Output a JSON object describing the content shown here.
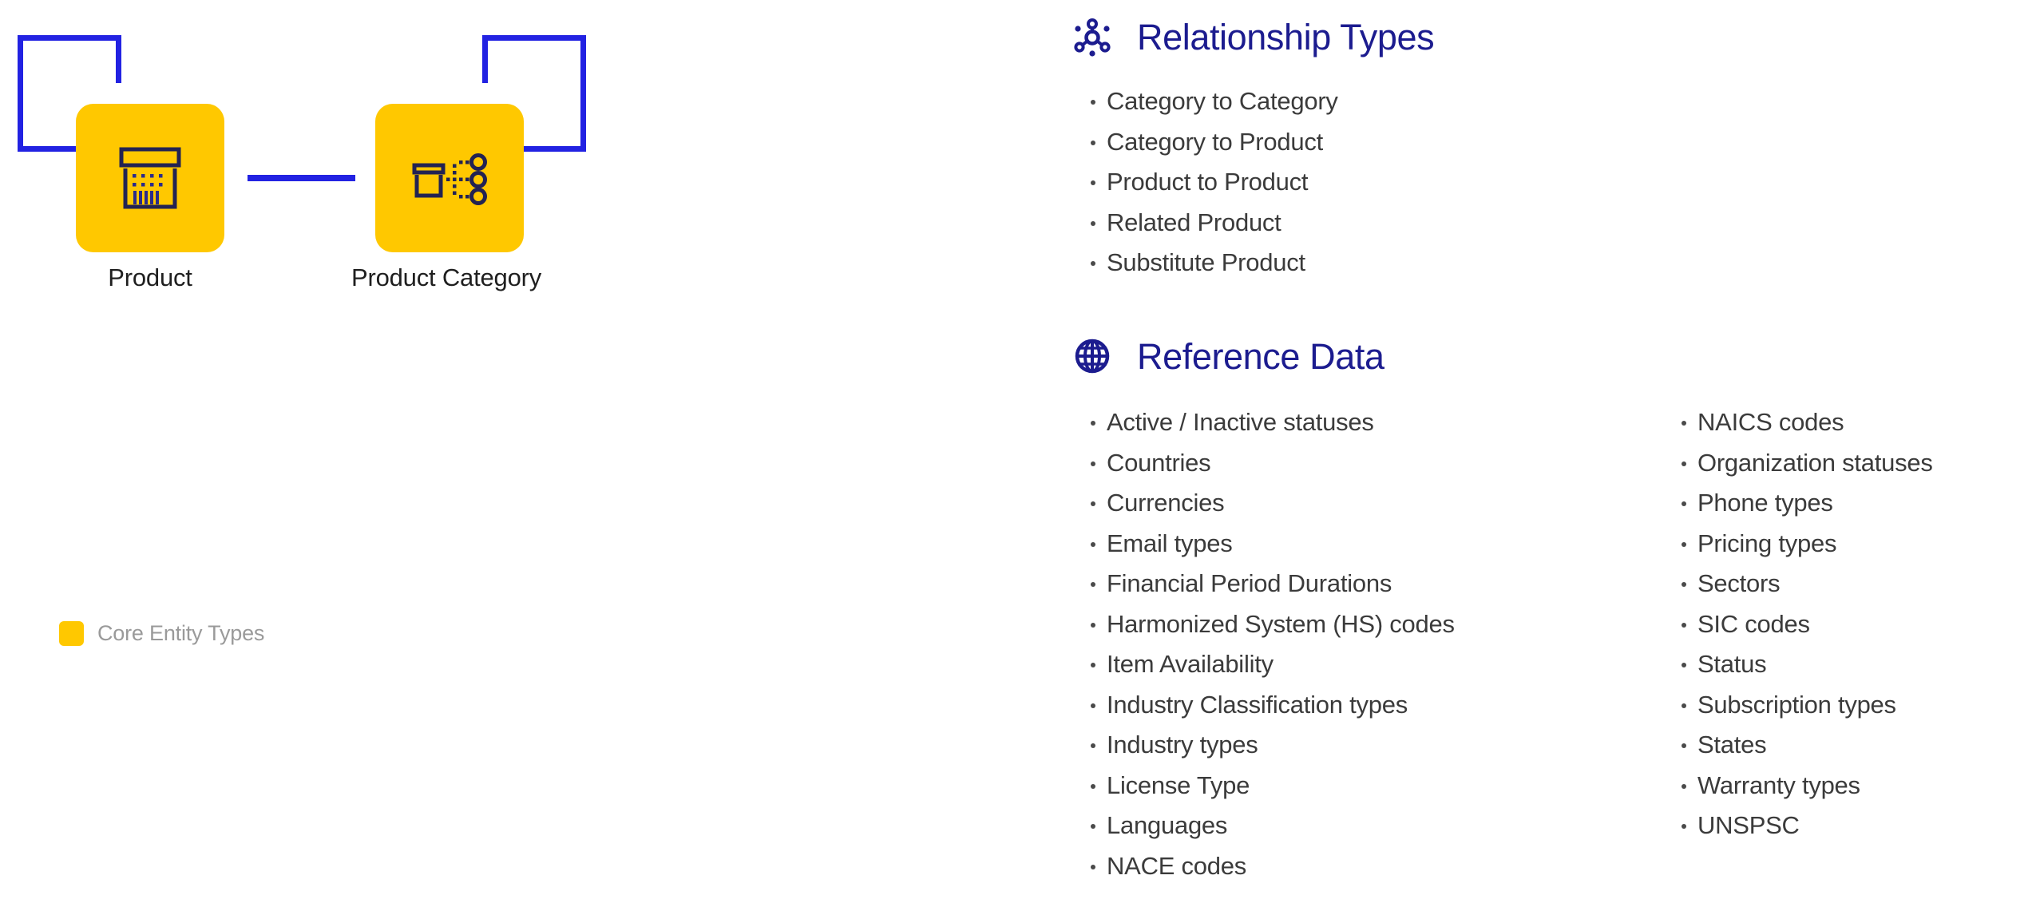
{
  "colors": {
    "entity_yellow": "#FFC800",
    "bracket_blue": "#2222E2",
    "heading_navy": "#1C1C8F",
    "icon_stroke": "#232352",
    "body_text": "#3B3B3B",
    "legend_text": "#9A9A9A"
  },
  "diagram": {
    "entities": [
      {
        "label": "Product",
        "icon": "product-box-barcode-icon"
      },
      {
        "label": "Product Category",
        "icon": "product-category-hierarchy-icon"
      }
    ],
    "connector": "horizontal-link",
    "brackets": [
      "left-bracket",
      "right-bracket"
    ]
  },
  "legend": {
    "swatch_color": "#FFC800",
    "label": "Core Entity Types"
  },
  "sections": [
    {
      "id": "relationship-types",
      "icon": "molecule-network-icon",
      "title": "Relationship Types",
      "columns": [
        [
          "Category to Category",
          "Category to Product",
          "Product to Product",
          "Related Product",
          "Substitute Product"
        ]
      ]
    },
    {
      "id": "reference-data",
      "icon": "globe-icon",
      "title": "Reference Data",
      "columns": [
        [
          "Active / Inactive statuses",
          "Countries",
          "Currencies",
          "Email types",
          "Financial Period Durations",
          "Harmonized System (HS) codes",
          "Item Availability",
          "Industry Classification types",
          "Industry types",
          "License Type",
          "Languages",
          "NACE codes"
        ],
        [
          "NAICS codes",
          "Organization statuses",
          "Phone types",
          "Pricing types",
          "Sectors",
          "SIC codes",
          "Status",
          "Subscription types",
          "States",
          "Warranty types",
          "UNSPSC"
        ]
      ]
    }
  ]
}
